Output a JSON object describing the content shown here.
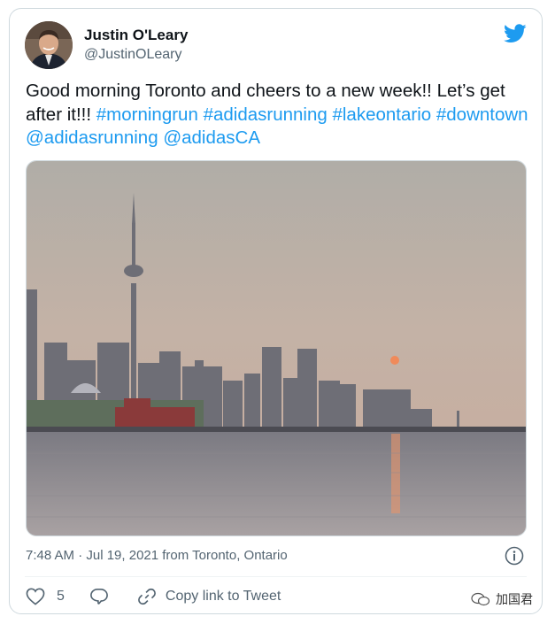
{
  "tweet": {
    "author_name": "Justin O'Leary",
    "author_handle": "@JustinOLeary",
    "text_plain": "Good morning Toronto and cheers to a new week!! Let’s get after it!!!",
    "hashtags": [
      "#morningrun",
      "#adidasrunning",
      "#lakeontario",
      "#downtown"
    ],
    "mentions": [
      "@adidasrunning",
      "@adidasCA"
    ],
    "timestamp": "7:48 AM · Jul 19, 2021 from Toronto, Ontario",
    "likes": "5",
    "copy_link_label": "Copy link to Tweet"
  },
  "watermark": {
    "text": "加国君"
  },
  "icons": {
    "brand": "twitter-bird-icon",
    "info": "info-icon",
    "like": "heart-icon",
    "reply": "reply-bubble-icon",
    "link": "link-icon"
  },
  "colors": {
    "link": "#1d9bf0",
    "secondary_text": "#536471",
    "border": "#cfd9de",
    "twitter_blue": "#1d9bf0"
  }
}
